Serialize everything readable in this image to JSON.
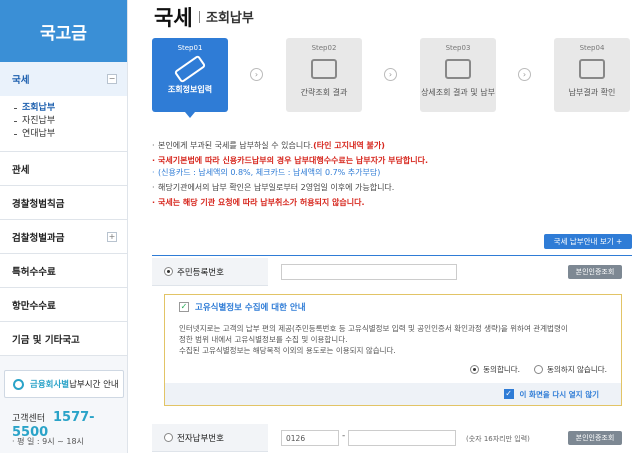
{
  "sidebar": {
    "title": "국고금",
    "menu": [
      {
        "label": "국세",
        "toggle": "−"
      },
      {
        "label": "관세"
      },
      {
        "label": "경찰청범칙금"
      },
      {
        "label": "검찰청벌과금",
        "toggle": "+"
      },
      {
        "label": "특허수수료"
      },
      {
        "label": "항만수수료"
      },
      {
        "label": "기금 및 기타국고"
      }
    ],
    "submenu": [
      "조회납부",
      "자진납부",
      "연대납부"
    ],
    "hours_box": {
      "highlight": "금융회사별",
      "rest": " 납부시간 안내"
    },
    "center": {
      "label": "고객센터",
      "number": "1577-5500"
    },
    "hours_detail": "· 평  일 : 9시 ~ 18시"
  },
  "main": {
    "title": "국세",
    "subtitle": "조회납부",
    "steps": [
      {
        "step": "Step01",
        "name": "조회정보입력"
      },
      {
        "step": "Step02",
        "name": "간략조회 결과"
      },
      {
        "step": "Step03",
        "name": "상세조회 결과 및 납부"
      },
      {
        "step": "Step04",
        "name": "납부결과 확인"
      }
    ],
    "notes": {
      "n1_text": "본인에게 부과된 국세를 납부하실 수 있습니다.",
      "n1_red": "(타인 고지내역 불가)",
      "n2": "국세기본법에 따라 신용카드납부의 경우 납부대행수수료는 납부자가 부담합니다.",
      "n2_sub": "(신용카드 : 납세액의 0.8%, 체크카드 : 납세액의 0.7% 추가부담)",
      "n3": "해당기관에서의 납부 확인은 납부일로부터 2영업일 이후에 가능합니다.",
      "n4": "국세는 해당 기관 요청에 따라 납부취소가 허용되지 않습니다."
    },
    "guide_button": "국세 납부안내 보기  +",
    "form": {
      "rrn_label": "주민등록번호",
      "cert_button": "본인인증조회",
      "consent_title": "고유식별정보 수집에 대한 안내",
      "consent_body_1": "인터넷지로는 고객의 납부 편의 제공(주민등록번호 등 고유식별정보 입력 및 공인인증서 확인과정 생략)을 위하여 관계법령이",
      "consent_body_2": "정한 범위 내에서 고유식별정보를 수집 및 이용합니다.",
      "consent_body_3": "수집된 고유식별정보는 해당목적 이외의 용도로는 이용되지 않습니다.",
      "agree": "동의합니다.",
      "disagree": "동의하지 않습니다.",
      "no_show": "이 화면을 다시 열지 않기",
      "epay_label": "전자납부번호",
      "epay_prefix": "0126",
      "epay_dash": "-",
      "epay_hint": "(숫자 16자리만 입력)",
      "cert_button_2": "본인인증조회"
    }
  }
}
